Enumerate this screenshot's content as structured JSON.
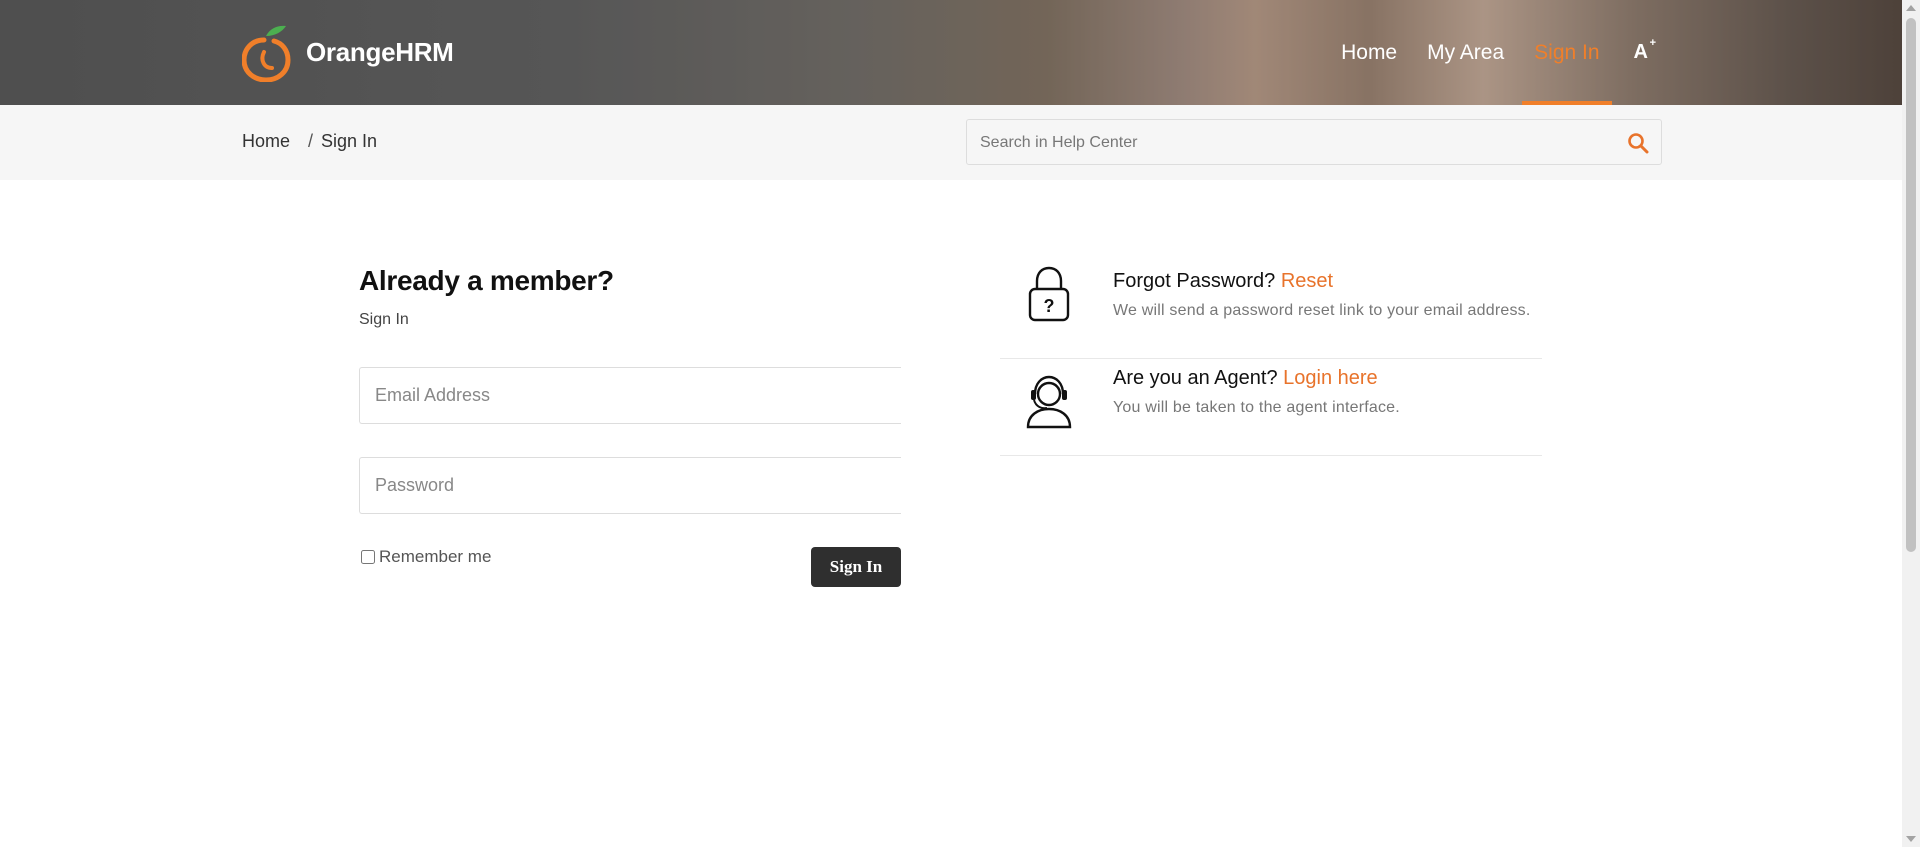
{
  "brand": {
    "name": "OrangeHRM"
  },
  "nav": {
    "items": [
      {
        "label": "Home"
      },
      {
        "label": "My Area"
      },
      {
        "label": "Sign In",
        "active": true
      }
    ],
    "font_toggle": "A",
    "font_toggle_sup": "+"
  },
  "breadcrumb": {
    "home": "Home",
    "separator": "/",
    "current": "Sign In"
  },
  "search": {
    "placeholder": "Search in Help Center",
    "value": ""
  },
  "form": {
    "title": "Already a member?",
    "subtitle": "Sign In",
    "email_placeholder": "Email Address",
    "password_placeholder": "Password",
    "remember_label": "Remember me",
    "submit_label": "Sign In"
  },
  "info": {
    "forgot": {
      "question": "Forgot Password?",
      "link": "Reset",
      "desc": "We will send a password reset link to your email address."
    },
    "agent": {
      "question": "Are you an Agent?",
      "link": "Login here",
      "desc": "You will be taken to the agent interface."
    }
  },
  "colors": {
    "accent": "#f07f2a",
    "link": "#e8732b",
    "button": "#2f2f2f"
  }
}
